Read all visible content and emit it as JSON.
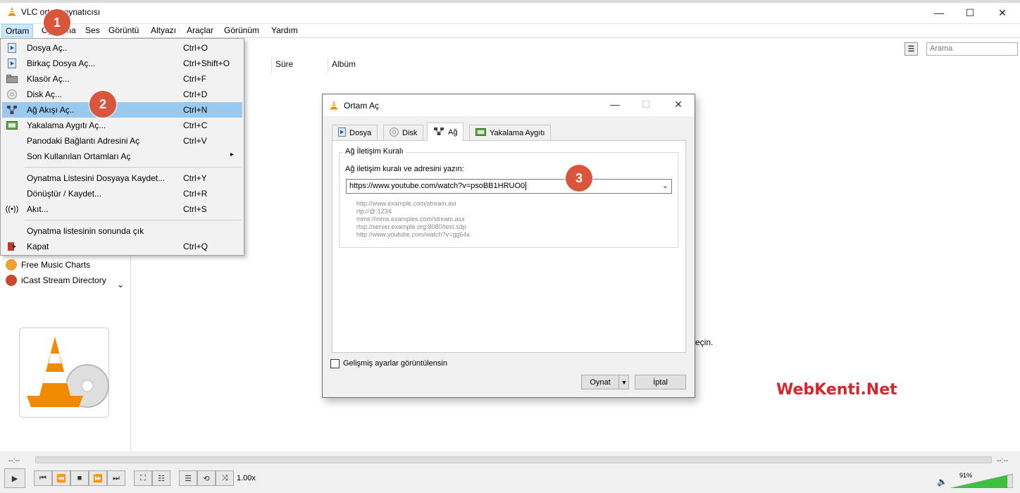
{
  "window": {
    "title": "VLC ortam oynatıcısı",
    "minimize": "—",
    "maximize": "☐",
    "close": "✕"
  },
  "menubar": [
    "Ortam",
    "Oynatma",
    "Ses",
    "Görüntü",
    "Altyazı",
    "Araçlar",
    "Görünüm",
    "Yardım"
  ],
  "dropdown": {
    "items": [
      {
        "label": "Dosya Aç..",
        "shortcut": "Ctrl+O",
        "icon": "file-icon"
      },
      {
        "label": "Birkaç Dosya Aç...",
        "shortcut": "Ctrl+Shift+O",
        "icon": "file-icon"
      },
      {
        "label": "Klasör Aç...",
        "shortcut": "Ctrl+F",
        "icon": "folder-icon"
      },
      {
        "label": "Disk Aç...",
        "shortcut": "Ctrl+D",
        "icon": "disc-icon"
      },
      {
        "label": "Ağ Akışı Aç..",
        "shortcut": "Ctrl+N",
        "icon": "network-icon"
      },
      {
        "label": "Yakalama Aygıtı Aç...",
        "shortcut": "Ctrl+C",
        "icon": "capture-icon"
      },
      {
        "label": "Panodaki Bağlantı Adresini Aç",
        "shortcut": "Ctrl+V",
        "icon": ""
      },
      {
        "label": "Son Kullanılan Ortamları Aç",
        "shortcut": "",
        "icon": ""
      },
      {
        "label": "Oynatma Listesini Dosyaya Kaydet...",
        "shortcut": "Ctrl+Y",
        "icon": ""
      },
      {
        "label": "Dönüştür / Kaydet...",
        "shortcut": "Ctrl+R",
        "icon": ""
      },
      {
        "label": "Akıt...",
        "shortcut": "Ctrl+S",
        "icon": "stream-icon"
      },
      {
        "label": "Oynatma listesinin sonunda çık",
        "shortcut": "",
        "icon": ""
      },
      {
        "label": "Kapat",
        "shortcut": "Ctrl+Q",
        "icon": "exit-icon"
      }
    ]
  },
  "badges": [
    "1",
    "2",
    "3"
  ],
  "sidebar": {
    "items": [
      {
        "label": "Free Music Charts"
      },
      {
        "label": "iCast Stream Directory"
      }
    ]
  },
  "playlist": {
    "columns": [
      "Süre",
      "Albüm"
    ],
    "search_placeholder": "Arama",
    "hint_fragment": "eçin."
  },
  "dialog": {
    "title": "Ortam Aç",
    "tabs": [
      "Dosya",
      "Disk",
      "Ağ",
      "Yakalama Aygıtı"
    ],
    "group_title": "Ağ İletişim Kuralı",
    "prompt": "Ağ iletişim kuralı ve adresini yazın:",
    "url_value": "https://www.youtube.com/watch?v=psoBB1HRUO0",
    "examples": [
      "http://www.example.com/stream.avi",
      "rtp://@:1234",
      "mms://mms.examples.com/stream.asx",
      "rtsp://server.example.org:8080/test.sdp",
      "http://www.youtube.com/watch?v=gg64x"
    ],
    "advanced_label": "Gelişmiş ayarlar görüntülensin",
    "play_label": "Oynat",
    "cancel_label": "İptal"
  },
  "watermark": "WebKenti.Net",
  "controls": {
    "time_elapsed": "--:--",
    "time_total": "--:--",
    "speed": "1.00x",
    "volume_pct": "91%",
    "volume_level": 0.91
  },
  "colors": {
    "badge": "#d9553b",
    "highlight": "#99c9ef",
    "watermark": "#d7262b",
    "vlc_orange": "#f08a00"
  }
}
